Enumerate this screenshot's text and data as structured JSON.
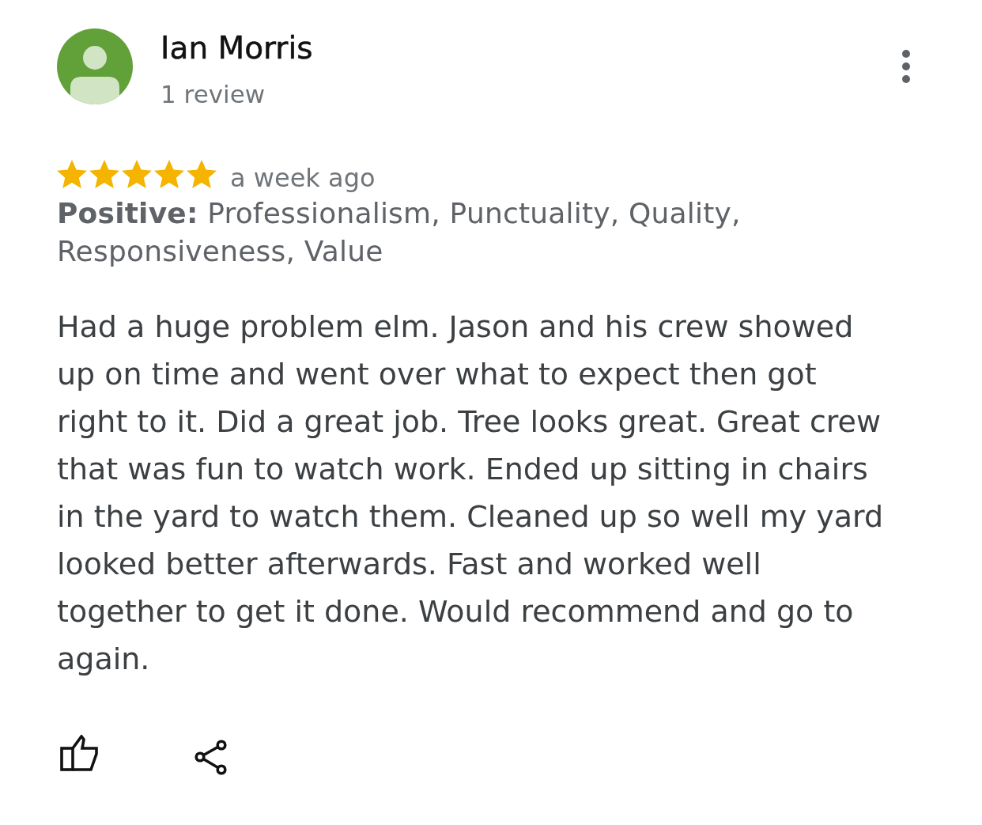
{
  "reviewer": {
    "name": "Ian Morris",
    "review_count": "1 review"
  },
  "review": {
    "stars": 5,
    "time": "a week ago",
    "attributes": "**Positive:** Professionalism, Punctuality, Quality, Responsiveness, Value",
    "text": "Had a huge problem elm. Jason and his crew showed up on time and went over what to expect then got right to it. Did a great job. Tree looks great. Great crew that was fun to watch work. Ended up sitting in chairs in the yard to watch them. Cleaned up so well my yard looked better afterwards. Fast and worked well together to get it done. Would recommend and go to again."
  },
  "actions": [
    {
      "kind": "like"
    },
    {
      "kind": "share"
    }
  ]
}
